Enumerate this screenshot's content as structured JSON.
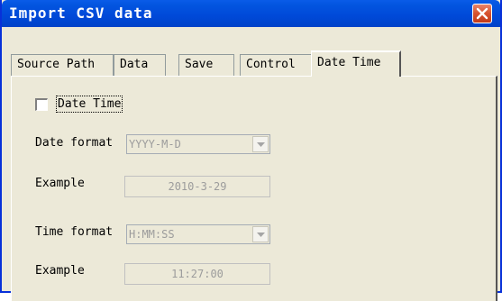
{
  "window": {
    "title": "Import CSV data"
  },
  "tabs": [
    {
      "label": "Source Path"
    },
    {
      "label": "Data"
    },
    {
      "label": "Save"
    },
    {
      "label": "Control"
    },
    {
      "label": "Date Time",
      "active": true
    }
  ],
  "date_time": {
    "checkbox_label": "Date Time",
    "checked": false,
    "date_format_label": "Date format",
    "date_format_value": "YYYY-M-D",
    "date_example_label": "Example",
    "date_example_value": "2010-3-29",
    "time_format_label": "Time format",
    "time_format_value": "H:MM:SS",
    "time_example_label": "Example",
    "time_example_value": "11:27:00"
  },
  "icons": {
    "close": "close-icon",
    "dropdown": "chevron-down-icon"
  },
  "colors": {
    "titlebar": "#0049d8",
    "close_button": "#d6522e",
    "dialog_background": "#ece9d8",
    "disabled_text": "#9c9c9c"
  }
}
